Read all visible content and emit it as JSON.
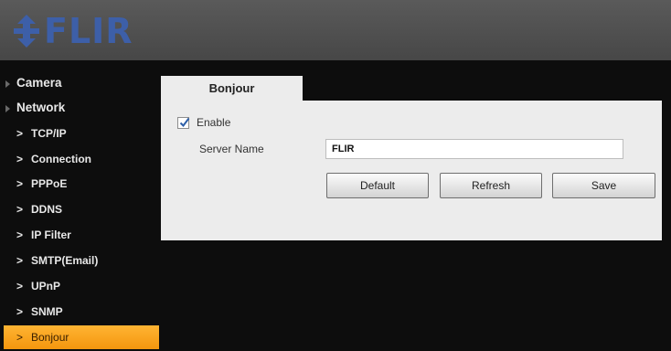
{
  "header": {
    "logo_text": "FLIR"
  },
  "sidebar": {
    "categories": [
      {
        "label": "Camera"
      },
      {
        "label": "Network"
      }
    ],
    "items": [
      {
        "label": "TCP/IP"
      },
      {
        "label": "Connection"
      },
      {
        "label": "PPPoE"
      },
      {
        "label": "DDNS"
      },
      {
        "label": "IP Filter"
      },
      {
        "label": "SMTP(Email)"
      },
      {
        "label": "UPnP"
      },
      {
        "label": "SNMP"
      },
      {
        "label": "Bonjour",
        "active": true
      }
    ]
  },
  "main": {
    "tab_label": "Bonjour",
    "enable": {
      "label": "Enable",
      "checked": true
    },
    "server_name": {
      "label": "Server Name",
      "value": "FLIR"
    },
    "buttons": {
      "default": "Default",
      "refresh": "Refresh",
      "save": "Save"
    }
  },
  "colors": {
    "accent": "#f4a020",
    "logo": "#3d5fa8"
  }
}
